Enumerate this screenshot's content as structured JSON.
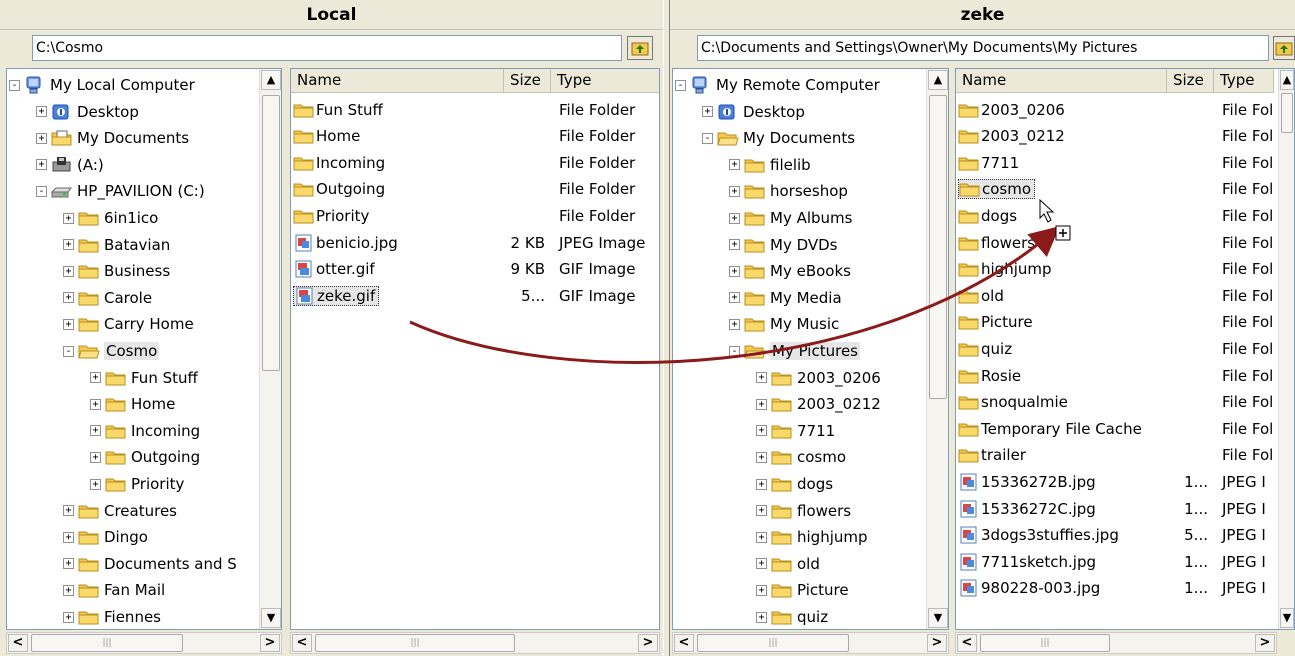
{
  "local": {
    "title": "Local",
    "path": "C:\\Cosmo",
    "tree": [
      {
        "label": "My Local Computer",
        "icon": "computer-icon",
        "exp": "-",
        "level": 0
      },
      {
        "label": "Desktop",
        "icon": "desktop-icon",
        "exp": "+",
        "level": 1
      },
      {
        "label": "My Documents",
        "icon": "my-documents-icon",
        "exp": "+",
        "level": 1
      },
      {
        "label": "(A:)",
        "icon": "floppy-drive-icon",
        "exp": "+",
        "level": 1
      },
      {
        "label": "HP_PAVILION (C:)",
        "icon": "hard-drive-icon",
        "exp": "-",
        "level": 1
      },
      {
        "label": "6in1ico",
        "icon": "folder-icon",
        "exp": "+",
        "level": 2
      },
      {
        "label": "Batavian",
        "icon": "folder-icon",
        "exp": "+",
        "level": 2
      },
      {
        "label": "Business",
        "icon": "folder-icon",
        "exp": "+",
        "level": 2
      },
      {
        "label": "Carole",
        "icon": "folder-icon",
        "exp": "+",
        "level": 2
      },
      {
        "label": "Carry Home",
        "icon": "folder-icon",
        "exp": "+",
        "level": 2
      },
      {
        "label": "Cosmo",
        "icon": "folder-open-icon",
        "exp": "-",
        "level": 2,
        "selected": true
      },
      {
        "label": "Fun Stuff",
        "icon": "folder-icon",
        "exp": "+",
        "level": 3
      },
      {
        "label": "Home",
        "icon": "folder-icon",
        "exp": "+",
        "level": 3
      },
      {
        "label": "Incoming",
        "icon": "folder-icon",
        "exp": "+",
        "level": 3
      },
      {
        "label": "Outgoing",
        "icon": "folder-icon",
        "exp": "+",
        "level": 3
      },
      {
        "label": "Priority",
        "icon": "folder-icon",
        "exp": "+",
        "level": 3
      },
      {
        "label": "Creatures",
        "icon": "folder-icon",
        "exp": "+",
        "level": 2
      },
      {
        "label": "Dingo",
        "icon": "folder-icon",
        "exp": "+",
        "level": 2
      },
      {
        "label": "Documents and S",
        "icon": "folder-icon",
        "exp": "+",
        "level": 2
      },
      {
        "label": "Fan Mail",
        "icon": "folder-icon",
        "exp": "+",
        "level": 2
      },
      {
        "label": "Fiennes",
        "icon": "folder-icon",
        "exp": "+",
        "level": 2
      }
    ],
    "columns": {
      "name": "Name",
      "size": "Size",
      "type": "Type"
    },
    "files": [
      {
        "name": "Fun Stuff",
        "size": "",
        "type": "File Folder",
        "icon": "folder-icon"
      },
      {
        "name": "Home",
        "size": "",
        "type": "File Folder",
        "icon": "folder-icon"
      },
      {
        "name": "Incoming",
        "size": "",
        "type": "File Folder",
        "icon": "folder-icon"
      },
      {
        "name": "Outgoing",
        "size": "",
        "type": "File Folder",
        "icon": "folder-icon"
      },
      {
        "name": "Priority",
        "size": "",
        "type": "File Folder",
        "icon": "folder-icon"
      },
      {
        "name": "benicio.jpg",
        "size": "2 KB",
        "type": "JPEG Image",
        "icon": "jpeg-file-icon"
      },
      {
        "name": "otter.gif",
        "size": "9 KB",
        "type": "GIF Image",
        "icon": "gif-file-icon"
      },
      {
        "name": "zeke.gif",
        "size": "5...",
        "type": "GIF Image",
        "icon": "gif-file-icon",
        "focused": true
      }
    ]
  },
  "remote": {
    "title": "zeke",
    "path": "C:\\Documents and Settings\\Owner\\My Documents\\My Pictures",
    "tree": [
      {
        "label": "My Remote Computer",
        "icon": "computer-icon",
        "exp": "-",
        "level": 0
      },
      {
        "label": "Desktop",
        "icon": "desktop-icon",
        "exp": "+",
        "level": 1
      },
      {
        "label": "My Documents",
        "icon": "folder-open-icon",
        "exp": "-",
        "level": 1
      },
      {
        "label": "filelib",
        "icon": "folder-icon",
        "exp": "+",
        "level": 2
      },
      {
        "label": "horseshop",
        "icon": "folder-icon",
        "exp": "+",
        "level": 2
      },
      {
        "label": "My Albums",
        "icon": "folder-icon",
        "exp": "+",
        "level": 2
      },
      {
        "label": "My DVDs",
        "icon": "folder-icon",
        "exp": "+",
        "level": 2
      },
      {
        "label": "My eBooks",
        "icon": "folder-icon",
        "exp": "+",
        "level": 2
      },
      {
        "label": "My Media",
        "icon": "folder-icon",
        "exp": "+",
        "level": 2
      },
      {
        "label": "My Music",
        "icon": "folder-icon",
        "exp": "+",
        "level": 2
      },
      {
        "label": "My Pictures",
        "icon": "folder-open-icon",
        "exp": "-",
        "level": 2,
        "selected": true
      },
      {
        "label": "2003_0206",
        "icon": "folder-icon",
        "exp": "+",
        "level": 3
      },
      {
        "label": "2003_0212",
        "icon": "folder-icon",
        "exp": "+",
        "level": 3
      },
      {
        "label": "7711",
        "icon": "folder-icon",
        "exp": "+",
        "level": 3
      },
      {
        "label": "cosmo",
        "icon": "folder-icon",
        "exp": "+",
        "level": 3
      },
      {
        "label": "dogs",
        "icon": "folder-icon",
        "exp": "+",
        "level": 3
      },
      {
        "label": "flowers",
        "icon": "folder-icon",
        "exp": "+",
        "level": 3
      },
      {
        "label": "highjump",
        "icon": "folder-icon",
        "exp": "+",
        "level": 3
      },
      {
        "label": "old",
        "icon": "folder-icon",
        "exp": "+",
        "level": 3
      },
      {
        "label": "Picture",
        "icon": "folder-icon",
        "exp": "+",
        "level": 3
      },
      {
        "label": "quiz",
        "icon": "folder-icon",
        "exp": "+",
        "level": 3
      }
    ],
    "columns": {
      "name": "Name",
      "size": "Size",
      "type": "Type"
    },
    "files": [
      {
        "name": "2003_0206",
        "size": "",
        "type": "File Fol",
        "icon": "folder-icon"
      },
      {
        "name": "2003_0212",
        "size": "",
        "type": "File Fol",
        "icon": "folder-icon"
      },
      {
        "name": "7711",
        "size": "",
        "type": "File Fol",
        "icon": "folder-icon"
      },
      {
        "name": "cosmo",
        "size": "",
        "type": "File Fol",
        "icon": "folder-icon",
        "focused": true
      },
      {
        "name": "dogs",
        "size": "",
        "type": "File Fol",
        "icon": "folder-icon"
      },
      {
        "name": "flowers",
        "size": "",
        "type": "File Fol",
        "icon": "folder-icon"
      },
      {
        "name": "highjump",
        "size": "",
        "type": "File Fol",
        "icon": "folder-icon"
      },
      {
        "name": "old",
        "size": "",
        "type": "File Fol",
        "icon": "folder-icon"
      },
      {
        "name": "Picture",
        "size": "",
        "type": "File Fol",
        "icon": "folder-icon"
      },
      {
        "name": "quiz",
        "size": "",
        "type": "File Fol",
        "icon": "folder-icon"
      },
      {
        "name": "Rosie",
        "size": "",
        "type": "File Fol",
        "icon": "folder-icon"
      },
      {
        "name": "snoqualmie",
        "size": "",
        "type": "File Fol",
        "icon": "folder-icon"
      },
      {
        "name": "Temporary File Cache",
        "size": "",
        "type": "File Fol",
        "icon": "folder-icon"
      },
      {
        "name": "trailer",
        "size": "",
        "type": "File Fol",
        "icon": "folder-icon"
      },
      {
        "name": "15336272B.jpg",
        "size": "1...",
        "type": "JPEG I",
        "icon": "jpeg-file-icon"
      },
      {
        "name": "15336272C.jpg",
        "size": "1...",
        "type": "JPEG I",
        "icon": "jpeg-file-icon"
      },
      {
        "name": "3dogs3stuffies.jpg",
        "size": "5...",
        "type": "JPEG I",
        "icon": "jpeg-file-icon"
      },
      {
        "name": "7711sketch.jpg",
        "size": "1...",
        "type": "JPEG I",
        "icon": "jpeg-file-icon"
      },
      {
        "name": "980228-003.jpg",
        "size": "1...",
        "type": "JPEG I",
        "icon": "jpeg-file-icon"
      }
    ]
  },
  "colors": {
    "drag_arrow": "#8b1a1a",
    "folder": "#f5c84c",
    "selection": "#e6e6e6"
  },
  "icons": {
    "up": "folder-up-icon",
    "drag_copy": "copy-plus-icon"
  }
}
